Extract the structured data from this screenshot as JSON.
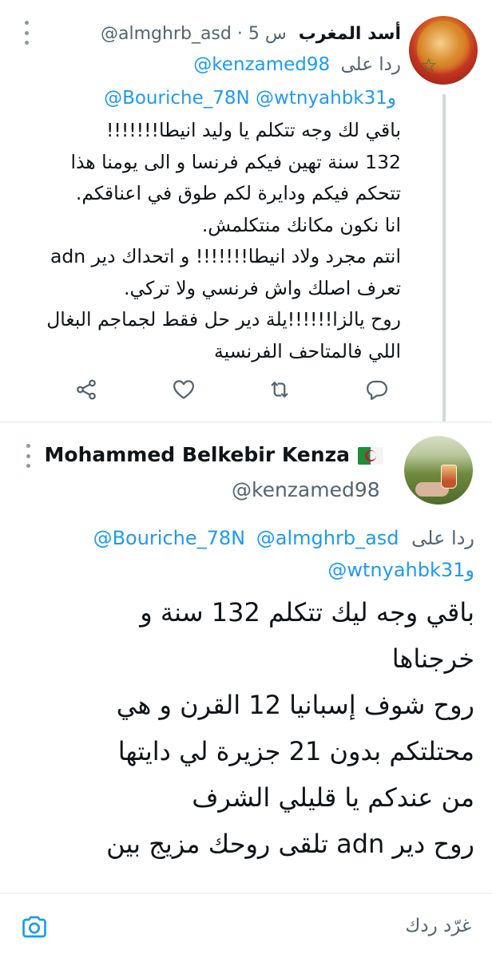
{
  "colors": {
    "accent": "#1d9bf0",
    "muted_text": "#536471",
    "primary_text": "#0f1419",
    "divider": "#eff3f4",
    "thread_line": "#cfd9de"
  },
  "tweet1": {
    "author_name": "أسد المغرب",
    "handle_time": "@almghrb_asd · 5 س",
    "replying_prefix": "ردا على",
    "replying_to_1": "@kenzamed98",
    "replying_to_2": "@Bouriche_78N",
    "replying_and": "و",
    "replying_to_3": "@wtnyahbk31",
    "body_lines": [
      "باقي لك وجه تتكلم يا وليد انيطا!!!!!!!",
      "132 سنة تهين فيكم فرنسا و الى يومنا هذا",
      "تتحكم فيكم ودايرة لكم طوق في اعناقكم.",
      "انا نكون مكانك منتكلمش.",
      "انتم مجرد ولاد انيطا!!!!!!! و اتحداك دير adn",
      "تعرف اصلك واش فرنسي ولا تركي.",
      "روح يالزا!!!!!!يلة دير حل فقط لجماجم البغال",
      "اللي فالمتاحف الفرنسية"
    ],
    "actions": {
      "reply_icon": "reply-icon",
      "retweet_icon": "retweet-icon",
      "like_icon": "heart-icon",
      "share_icon": "share-icon"
    },
    "avatar_icon": "lion-avatar"
  },
  "tweet2": {
    "author_name": "Mohammed Belkebir Kenza",
    "flag_icon": "algeria-flag-icon",
    "handle": "@kenzamed98",
    "replying_prefix": "ردا على",
    "replying_to_1": "@Bouriche_78N",
    "replying_to_2": "@almghrb_asd",
    "replying_and": "و",
    "replying_to_3": "@wtnyahbk31",
    "body_lines": [
      "باقي وجه ليك تتكلم 132 سنة و",
      "خرجناها",
      "روح شوف إسبانيا 12 القرن و هي",
      "محتلتكم بدون 21 جزيرة لي دايتها",
      "من عندكم يا قليلي الشرف",
      "روح دير adn تلقى روحك مزيج بين"
    ],
    "avatar_icon": "landscape-avatar"
  },
  "compose": {
    "placeholder": "غرّد ردك",
    "camera_icon": "camera-icon"
  }
}
